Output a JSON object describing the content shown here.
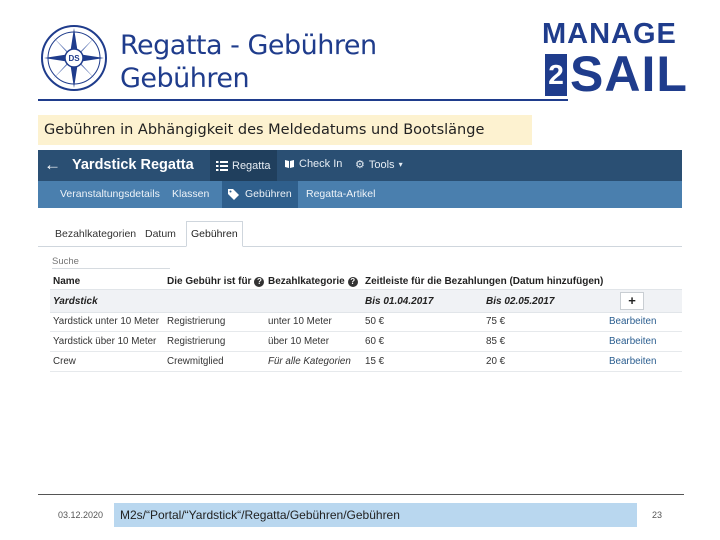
{
  "slide": {
    "title_line1": "Regatta - Gebühren",
    "title_line2": "Gebühren",
    "subtitle": "Gebühren in Abhängigkeit des Meldedatums und Bootslänge",
    "brand_top": "MANAGE",
    "brand_digit": "2",
    "brand_bottom": "SAIL",
    "emblem_text": "DS",
    "footer_date": "03.12.2020",
    "footer_path": "M2s/“Portal/“Yardstick“/Regatta/Gebühren/Gebühren",
    "page_number": "23"
  },
  "colors": {
    "brand": "#1f3c8c",
    "topbar": "#2a4f73",
    "subnav": "#4a7fae",
    "highlight": "#fdf2d0",
    "footer_box": "#b9d7ef"
  },
  "app": {
    "title": "Yardstick Regatta",
    "back_icon": "arrow-left-icon",
    "topnav": [
      {
        "label": "Regatta",
        "icon": "list-icon"
      },
      {
        "label": "Check In",
        "icon": "book-icon"
      },
      {
        "label": "Tools",
        "icon": "gear-icon"
      }
    ],
    "subnav": [
      "Veranstaltungsdetails",
      "Klassen",
      "Gebühren",
      "Regatta-Artikel"
    ],
    "subnav_active_icon": "tags-icon",
    "tabs": [
      "Bezahlkategorien",
      "Datum",
      "Gebühren"
    ],
    "search_placeholder": "Suche",
    "columns": {
      "name": "Name",
      "fee_for": "Die Gebühr ist für",
      "category": "Bezahlkategorie",
      "timeline": "Zeitleiste für die Bezahlungen (Datum hinzufügen)"
    },
    "group": {
      "name": "Yardstick",
      "date1": "Bis 01.04.2017",
      "date2": "Bis 02.05.2017",
      "add_label": "+"
    },
    "rows": [
      {
        "name": "Yardstick unter 10 Meter",
        "fee_for": "Registrierung",
        "category": "unter 10 Meter",
        "price1": "50 €",
        "price2": "75 €",
        "action": "Bearbeiten"
      },
      {
        "name": "Yardstick über 10 Meter",
        "fee_for": "Registrierung",
        "category": "über 10 Meter",
        "price1": "60 €",
        "price2": "85 €",
        "action": "Bearbeiten"
      },
      {
        "name": "Crew",
        "fee_for": "Crewmitglied",
        "category": "Für alle Kategorien",
        "price1": "15 €",
        "price2": "20 €",
        "action": "Bearbeiten"
      }
    ]
  }
}
